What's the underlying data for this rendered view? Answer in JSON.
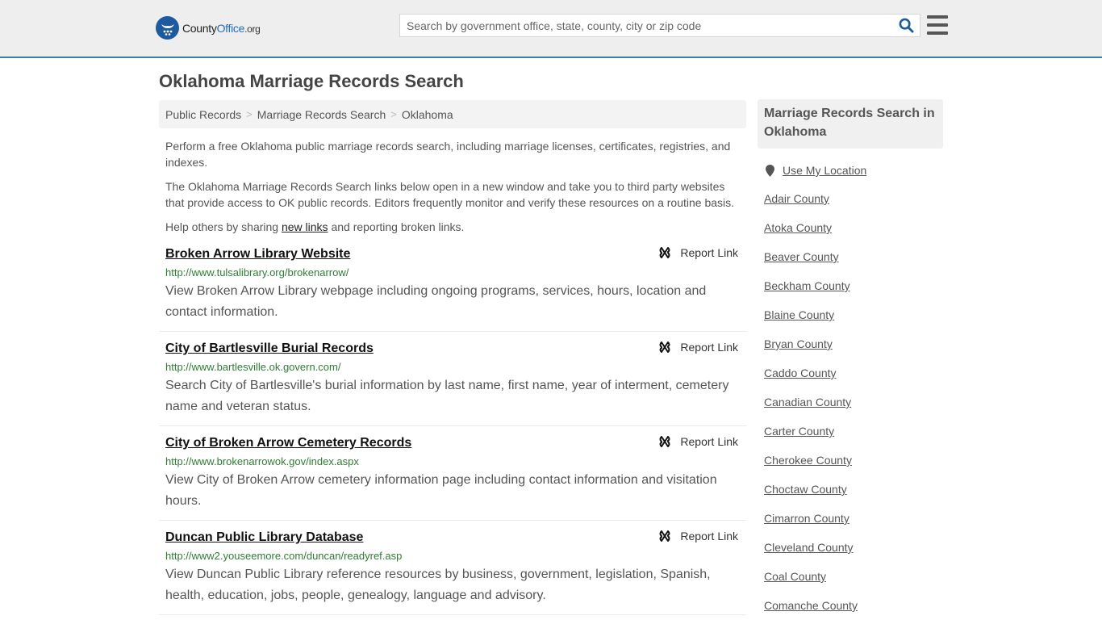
{
  "header": {
    "logo": {
      "name": "County",
      "brand": "Office",
      "tld": ".org"
    },
    "search": {
      "placeholder": "Search by government office, state, county, city or zip code",
      "value": ""
    },
    "accent_color": "#3b7fb0"
  },
  "page": {
    "title": "Oklahoma Marriage Records Search"
  },
  "breadcrumb": [
    {
      "label": "Public Records"
    },
    {
      "label": "Marriage Records Search"
    },
    {
      "label": "Oklahoma"
    }
  ],
  "intro": {
    "p1": "Perform a free Oklahoma public marriage records search, including marriage licenses, certificates, registries, and indexes.",
    "p2": "The Oklahoma Marriage Records Search links below open in a new window and take you to third party websites that provide access to OK public records. Editors frequently monitor and verify these resources on a routine basis.",
    "p3_before": "Help others by sharing ",
    "p3_link": "new links",
    "p3_after": " and reporting broken links."
  },
  "report_label": "Report Link",
  "entries": [
    {
      "title": "Broken Arrow Library Website",
      "url": "http://www.tulsalibrary.org/brokenarrow/",
      "description": "View Broken Arrow Library webpage including ongoing programs, services, hours, location and contact information."
    },
    {
      "title": "City of Bartlesville Burial Records",
      "url": "http://www.bartlesville.ok.govern.com/",
      "description": "Search City of Bartlesville's burial information by last name, first name, year of interment, cemetery name and veteran status."
    },
    {
      "title": "City of Broken Arrow Cemetery Records",
      "url": "http://www.brokenarrowok.gov/index.aspx",
      "description": "View City of Broken Arrow cemetery information page including contact information and visitation hours."
    },
    {
      "title": "Duncan Public Library Database",
      "url": "http://www2.youseemore.com/duncan/readyref.asp",
      "description": "View Duncan Public Library reference resources by business, government, legislation, Spanish, health, education, jobs, people, genealogy, language and advisory."
    }
  ],
  "sidebar": {
    "heading": "Marriage Records Search in Oklahoma",
    "use_location": "Use My Location",
    "counties": [
      "Adair County",
      "Atoka County",
      "Beaver County",
      "Beckham County",
      "Blaine County",
      "Bryan County",
      "Caddo County",
      "Canadian County",
      "Carter County",
      "Cherokee County",
      "Choctaw County",
      "Cimarron County",
      "Cleveland County",
      "Coal County",
      "Comanche County"
    ]
  }
}
